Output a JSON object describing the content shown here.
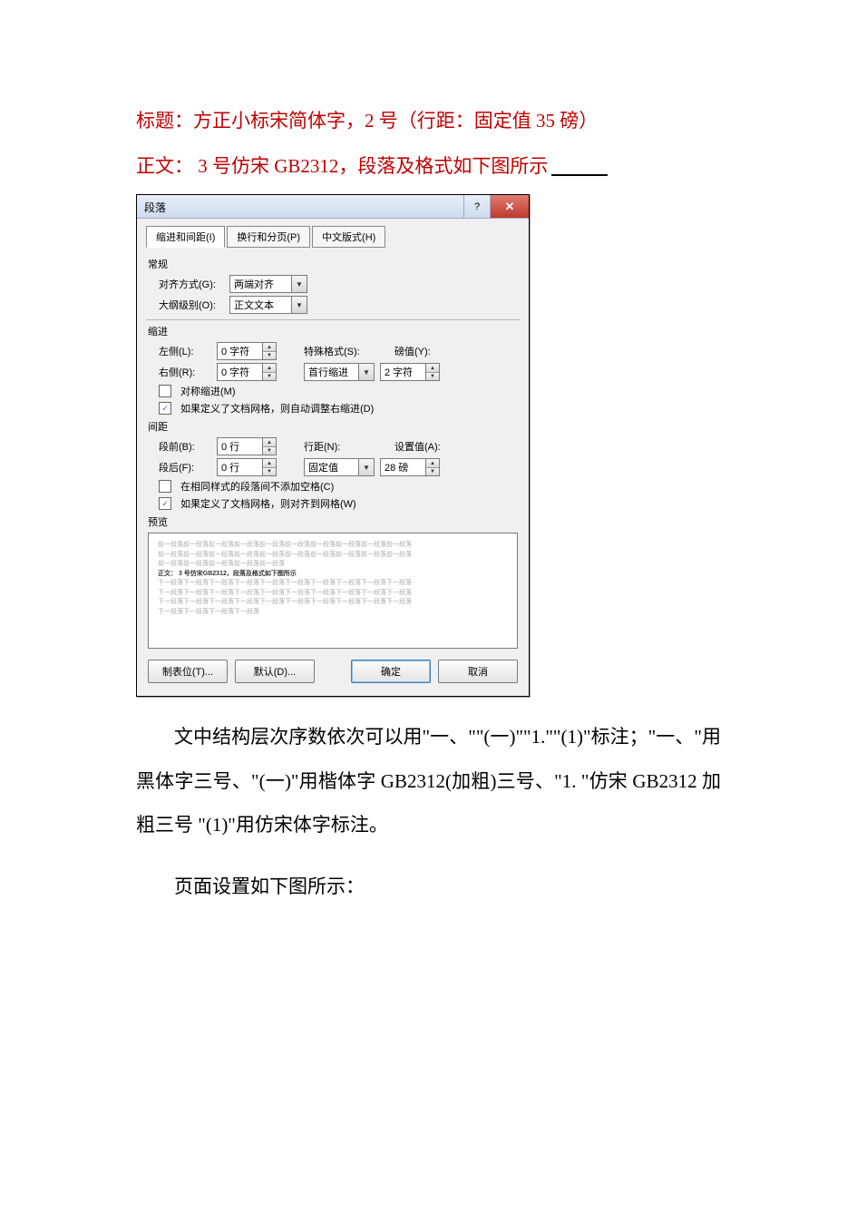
{
  "doc": {
    "title_line": "标题：方正小标宋简体字，2 号（行距：固定值 35 磅）",
    "body_line": "正文： 3 号仿宋 GB2312，段落及格式如下图所示",
    "para1": "文中结构层次序数依次可以用\"一、\"\"(一)\"\"1.\"\"(1)\"标注；\"一、\"用黑体字三号、\"(一)\"用楷体字 GB2312(加粗)三号、\"1. \"仿宋 GB2312 加粗三号 \"(1)\"用仿宋体字标注。",
    "para2": "页面设置如下图所示："
  },
  "dialog": {
    "title": "段落",
    "tabs": [
      "缩进和间距(I)",
      "换行和分页(P)",
      "中文版式(H)"
    ],
    "group_general": "常规",
    "alignment_label": "对齐方式(G):",
    "alignment_value": "两端对齐",
    "outline_label": "大纲级别(O):",
    "outline_value": "正文文本",
    "group_indent": "缩进",
    "left_label": "左侧(L):",
    "left_value": "0 字符",
    "right_label": "右侧(R):",
    "right_value": "0 字符",
    "special_label": "特殊格式(S):",
    "special_value": "首行缩进",
    "by_label": "磅值(Y):",
    "by_value": "2 字符",
    "mirror_indent": "对称缩进(M)",
    "auto_right_indent": "如果定义了文档网格，则自动调整右缩进(D)",
    "group_spacing": "间距",
    "before_label": "段前(B):",
    "before_value": "0 行",
    "after_label": "段后(F):",
    "after_value": "0 行",
    "line_spacing_label": "行距(N):",
    "line_spacing_value": "固定值",
    "at_label": "设置值(A):",
    "at_value": "28 磅",
    "no_space_same_style": "在相同样式的段落间不添加空格(C)",
    "snap_to_grid": "如果定义了文档网格，则对齐到网格(W)",
    "group_preview": "预览",
    "preview_sample": "正文： 3 号仿宋GB2312，段落及格式如下图所示",
    "btn_tabs": "制表位(T)...",
    "btn_default": "默认(D)...",
    "btn_ok": "确定",
    "btn_cancel": "取消"
  }
}
